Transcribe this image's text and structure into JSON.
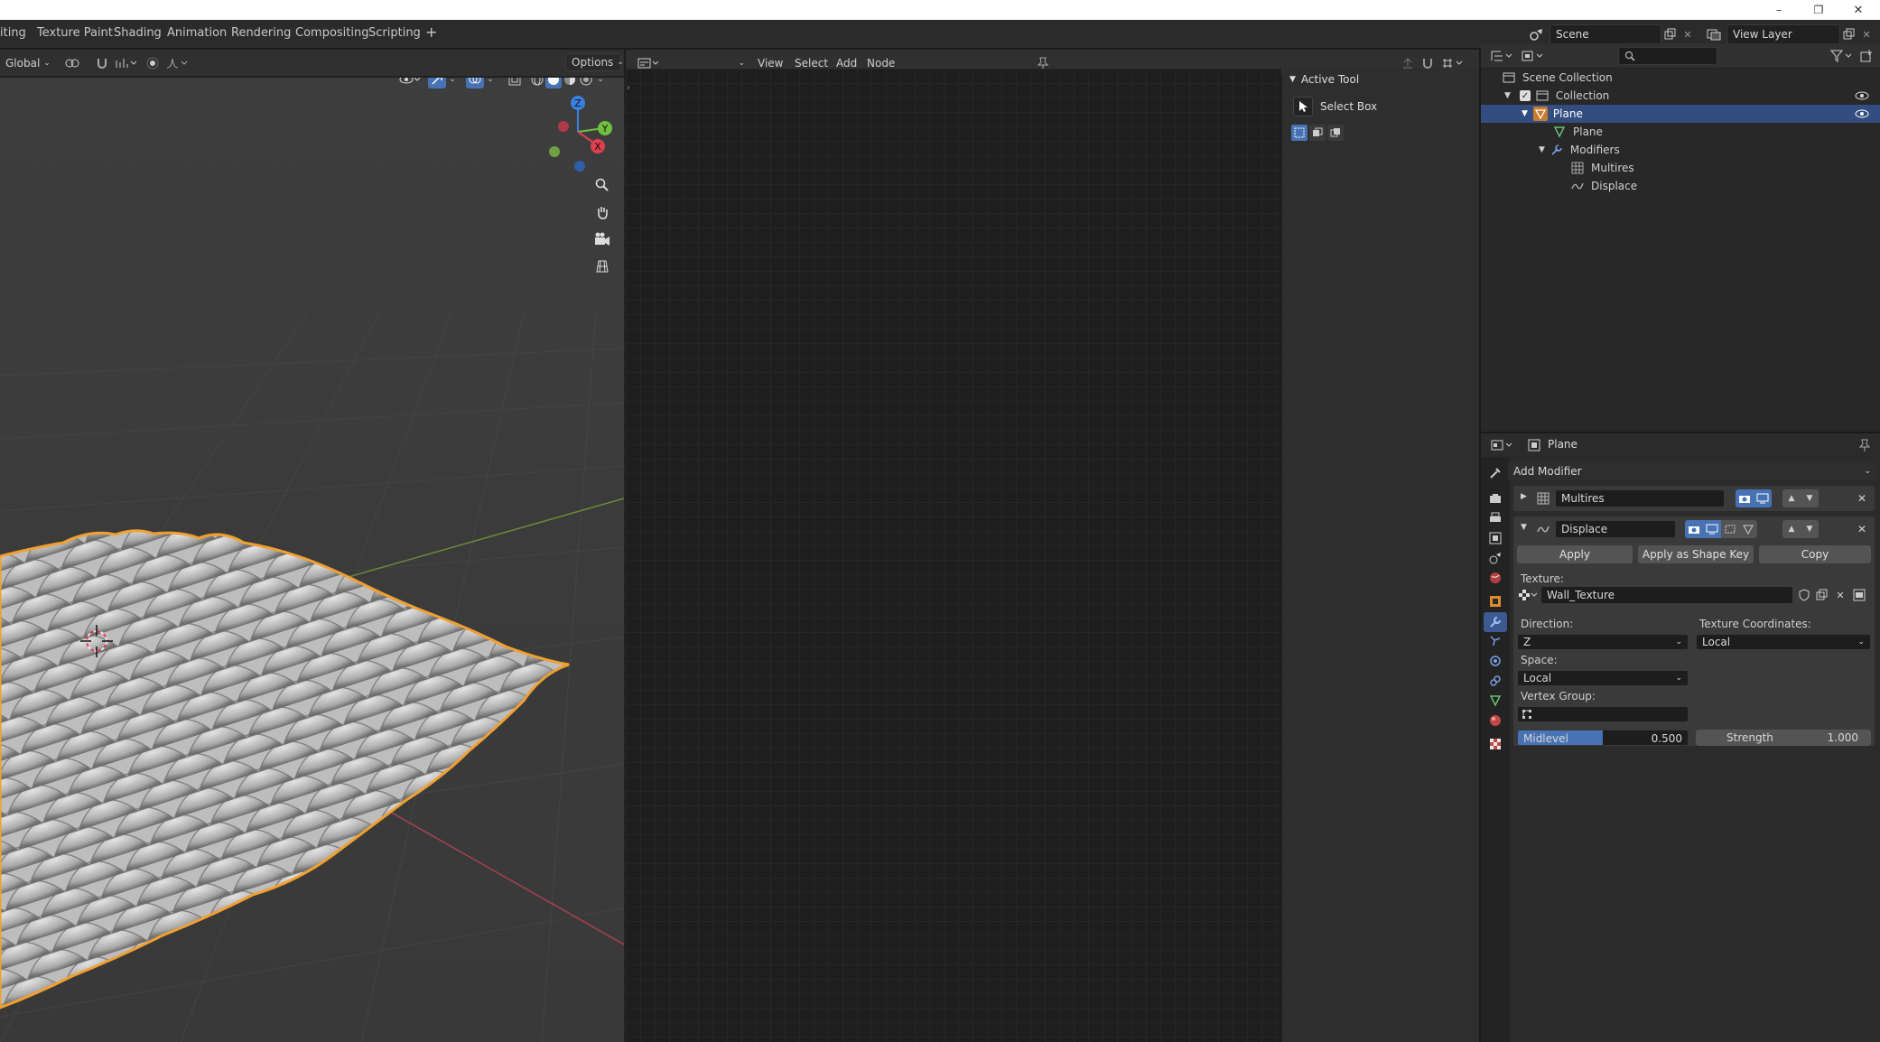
{
  "window": {
    "minimize": "–",
    "maximize": "❐",
    "close": "✕"
  },
  "workspaces": {
    "tabs": [
      "iting",
      "Texture Paint",
      "Shading",
      "Animation",
      "Rendering",
      "Compositing",
      "Scripting"
    ],
    "add": "+"
  },
  "scene": {
    "label": "Scene",
    "view_layer": "View Layer"
  },
  "viewport": {
    "orientation": "Global",
    "options": "Options",
    "gizmo_x": "X",
    "gizmo_y": "Y",
    "gizmo_z": "Z"
  },
  "node_editor": {
    "menus": [
      "View",
      "Select",
      "Add",
      "Node"
    ]
  },
  "active_tool": {
    "title": "Active Tool",
    "tool_name": "Select Box"
  },
  "outliner": {
    "rows": [
      {
        "label": "Scene Collection"
      },
      {
        "label": "Collection"
      },
      {
        "label": "Plane"
      },
      {
        "label": "Plane"
      },
      {
        "label": "Modifiers"
      },
      {
        "label": "Multires"
      },
      {
        "label": "Displace"
      }
    ]
  },
  "properties": {
    "object_name": "Plane",
    "add_modifier": "Add Modifier",
    "modifiers": [
      {
        "name": "Multires",
        "expanded": false
      },
      {
        "name": "Displace",
        "expanded": true
      }
    ],
    "apply": "Apply",
    "apply_shape_key": "Apply as Shape Key",
    "copy": "Copy",
    "texture_label": "Texture:",
    "texture_value": "Wall_Texture",
    "direction_label": "Direction:",
    "direction_value": "Z",
    "tex_coords_label": "Texture Coordinates:",
    "tex_coords_value": "Local",
    "space_label": "Space:",
    "space_value": "Local",
    "vertex_group_label": "Vertex Group:",
    "vertex_group_value": "",
    "midlevel_label": "Midlevel",
    "midlevel_value": "0.500",
    "midlevel_fraction": 0.5,
    "strength_label": "Strength",
    "strength_value": "1.000"
  },
  "colors": {
    "accent": "#4772b3",
    "selection": "#334d80",
    "object_outline": "#f0a030",
    "axis_x": "#e04050",
    "axis_y": "#70c040",
    "axis_z": "#3a80e0"
  }
}
